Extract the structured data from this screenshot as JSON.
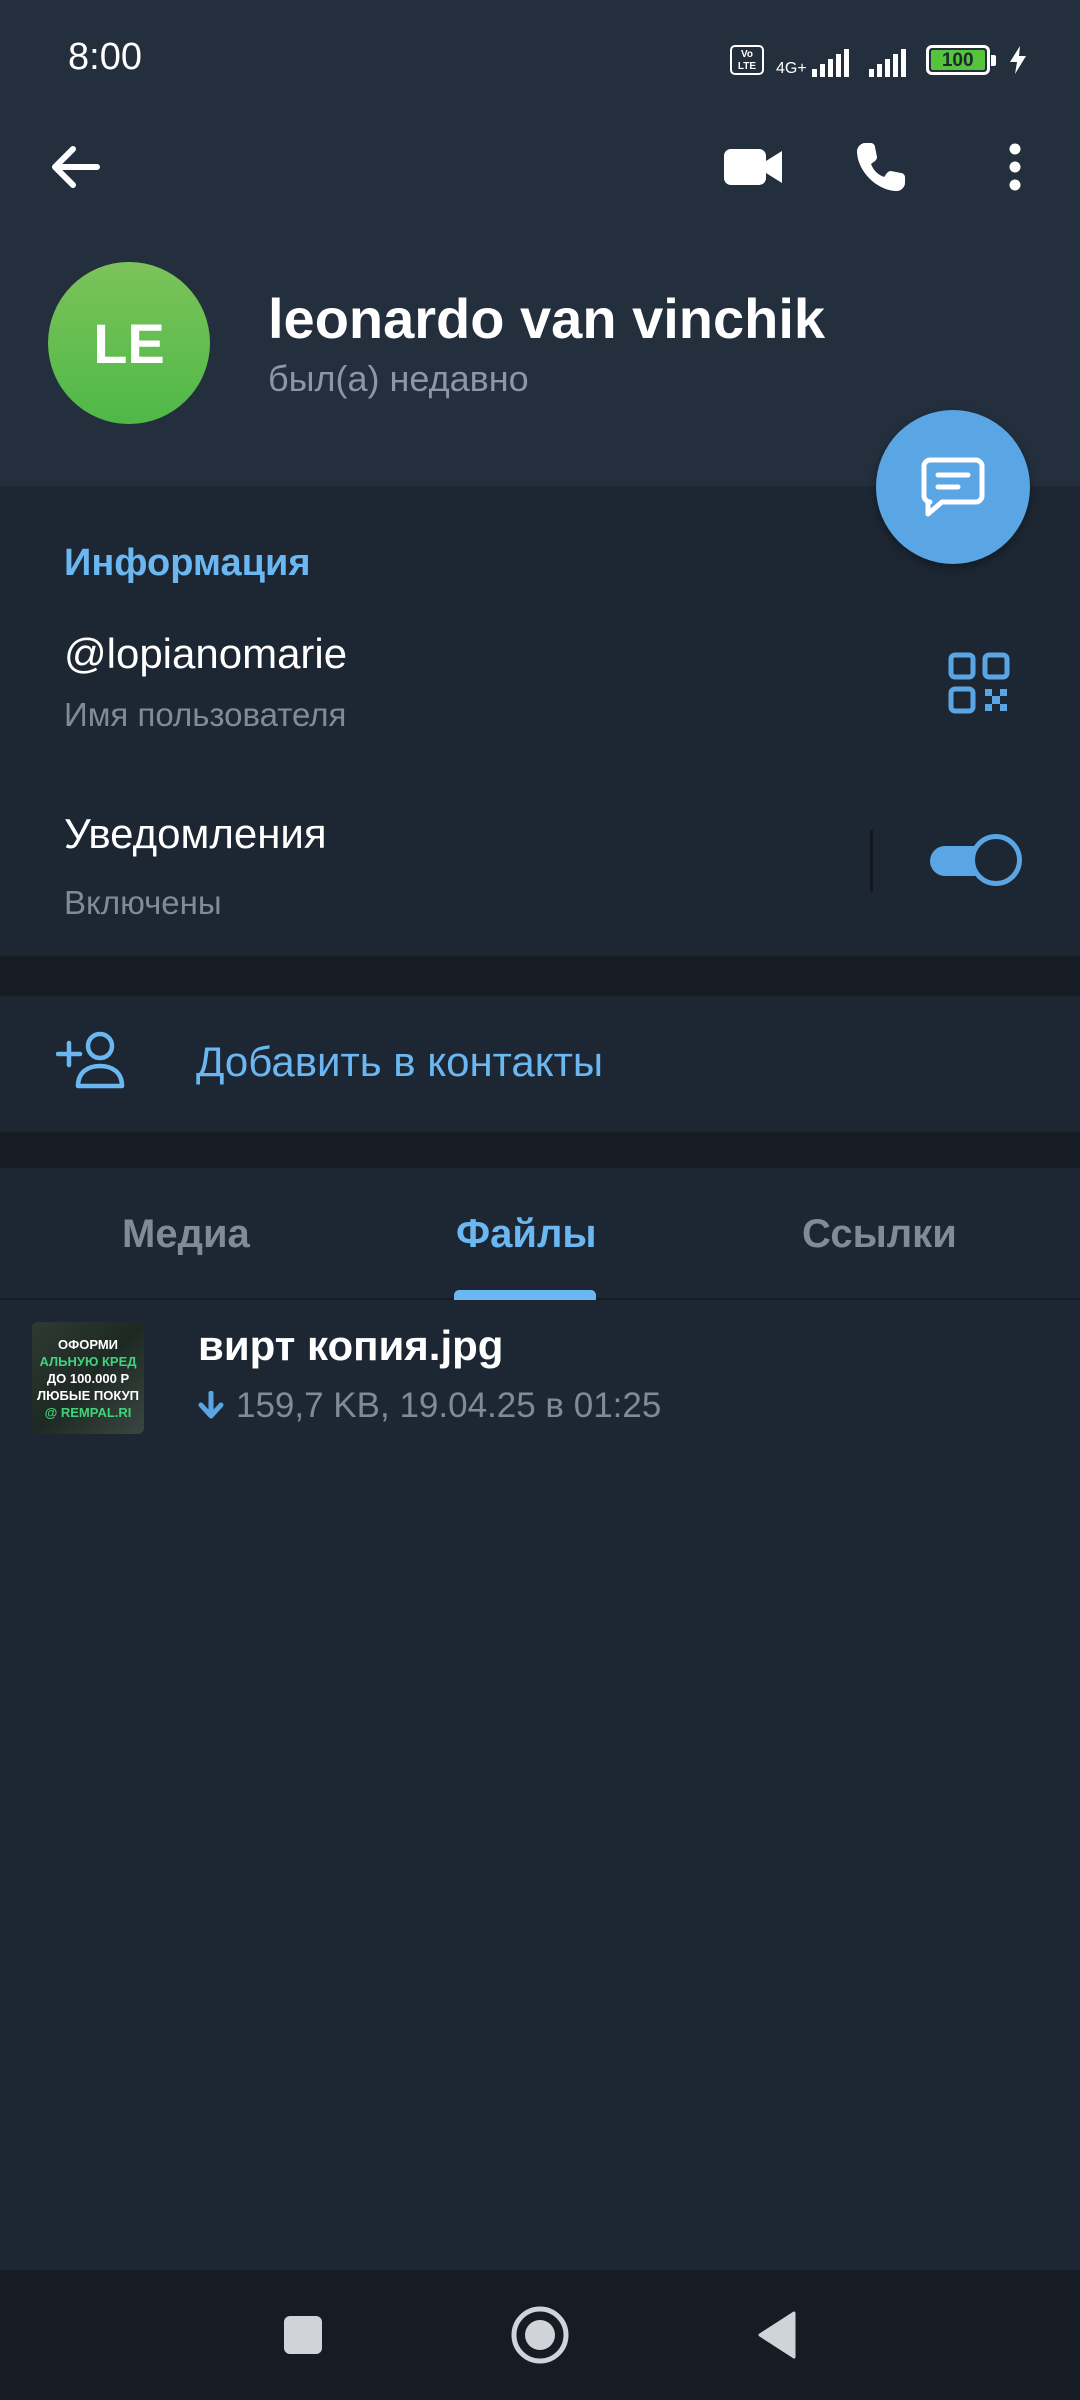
{
  "status_bar": {
    "time": "8:00",
    "volte": "Vo LTE",
    "network": "4G+",
    "battery": "100"
  },
  "header": {
    "back_icon": "arrow-left-icon",
    "video_icon": "video-camera-icon",
    "call_icon": "phone-icon",
    "menu_icon": "more-vertical-icon"
  },
  "profile": {
    "initials": "LE",
    "name": "leonardo van vinchik",
    "last_seen": "был(а) недавно",
    "avatar_color": "#5bbd4e"
  },
  "info": {
    "section_title": "Информация",
    "username": "@lopianomarie",
    "username_label": "Имя пользователя",
    "notifications_label": "Уведомления",
    "notifications_status": "Включены",
    "notifications_on": true
  },
  "add_contact": {
    "label": "Добавить в контакты"
  },
  "tabs": [
    {
      "label": "Медиа",
      "active": false
    },
    {
      "label": "Файлы",
      "active": true
    },
    {
      "label": "Ссылки",
      "active": false
    }
  ],
  "files": [
    {
      "name": "вирт копия.jpg",
      "meta": "159,7 KB, 19.04.25 в 01:25",
      "thumb_lines": [
        "ОФОРМИ",
        "АЛЬНУЮ КРЕД",
        "ДО 100.000 Р",
        "ЛЮБЫЕ ПОКУП",
        "@ REMPAL.RI"
      ]
    }
  ],
  "colors": {
    "accent": "#6ab7f2",
    "header_bg": "#242f3d",
    "body_bg": "#1d2733"
  }
}
